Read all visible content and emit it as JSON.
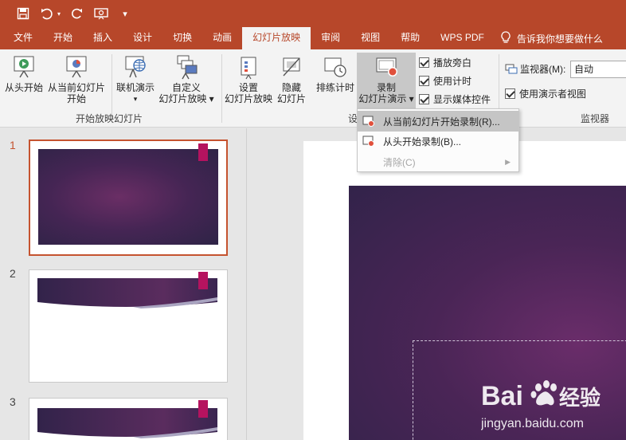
{
  "quick_access": {
    "icons": [
      "save-icon",
      "undo-icon",
      "redo-icon",
      "present-icon",
      "customize-icon"
    ]
  },
  "tabs": [
    "文件",
    "开始",
    "插入",
    "设计",
    "切换",
    "动画",
    "幻灯片放映",
    "审阅",
    "视图",
    "帮助",
    "WPS PDF"
  ],
  "active_tab": "幻灯片放映",
  "tell_me": "告诉我你想要做什么",
  "ribbon": {
    "from_start": "从头开始",
    "from_current_1": "从当前幻灯片",
    "from_current_2": "开始",
    "online_1": "联机演示",
    "online_2": "▾",
    "custom_1": "自定义",
    "custom_2": "幻灯片放映 ▾",
    "group_start": "开始放映幻灯片",
    "setup_1": "设置",
    "setup_2": "幻灯片放映",
    "hide_1": "隐藏",
    "hide_2": "幻灯片",
    "rehearse": "排练计时",
    "record_1": "录制",
    "record_2": "幻灯片演示 ▾",
    "group_setup": "设",
    "play_narration": "播放旁白",
    "use_timings": "使用计时",
    "show_media": "显示媒体控件",
    "monitor_label": "监视器(M):",
    "monitor_value": "自动",
    "presenter_view": "使用演示者视图",
    "group_monitor": "监视器"
  },
  "menu": {
    "items": [
      {
        "label": "从当前幻灯片开始录制(R)...",
        "enabled": true
      },
      {
        "label": "从头开始录制(B)...",
        "enabled": true
      },
      {
        "label": "清除(C)",
        "enabled": false
      }
    ]
  },
  "slides": [
    {
      "number": "1",
      "selected": true
    },
    {
      "number": "2",
      "selected": false
    },
    {
      "number": "3",
      "selected": false
    }
  ],
  "watermark": {
    "brand": "Bai",
    "brand_du": "经验",
    "url": "jingyan.baidu.com"
  },
  "colors": {
    "accent": "#b7472a",
    "slide_dark": "#32234a",
    "slide_magenta": "#b5135f"
  }
}
